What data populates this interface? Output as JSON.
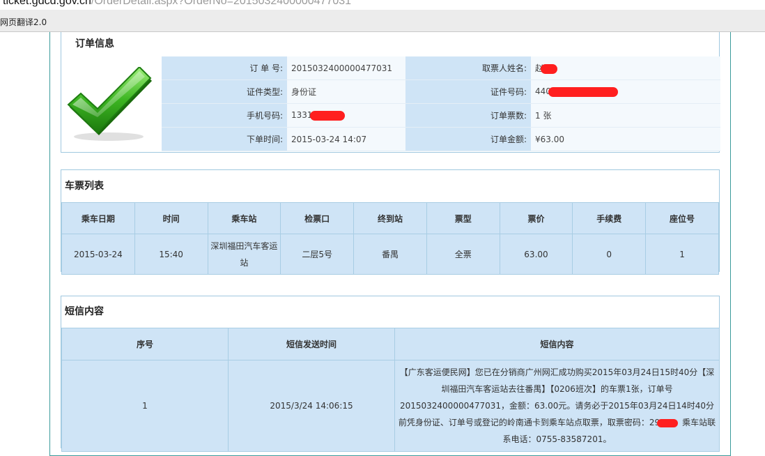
{
  "browser": {
    "url_host": "ticket.gdcd.gov.cn",
    "url_path": "/OrderDetail.aspx?OrderNo=2015032400000477031",
    "extension_label": "网页翻译2.0"
  },
  "order_info": {
    "title": "订单信息",
    "rows": [
      {
        "l1": "订 单 号:",
        "v1": "2015032400000477031",
        "l2": "取票人姓名:",
        "v2": "赵"
      },
      {
        "l1": "证件类型:",
        "v1": "身份证",
        "l2": "证件号码:",
        "v2": "440"
      },
      {
        "l1": "手机号码:",
        "v1": "1331",
        "l2": "订单票数:",
        "v2": "1 张"
      },
      {
        "l1": "下单时间:",
        "v1": "2015-03-24 14:07",
        "l2": "订单金额:",
        "v2": "¥63.00"
      }
    ]
  },
  "ticket_list": {
    "title": "车票列表",
    "columns": [
      "乘车日期",
      "时间",
      "乘车站",
      "检票口",
      "终到站",
      "票型",
      "票价",
      "手续费",
      "座位号"
    ],
    "rows": [
      [
        "2015-03-24",
        "15:40",
        "深圳福田汽车客运站",
        "二层5号",
        "番禺",
        "全票",
        "63.00",
        "0",
        "1"
      ]
    ]
  },
  "sms": {
    "title": "短信内容",
    "columns": [
      "序号",
      "短信发送时间",
      "短信内容"
    ],
    "row": {
      "index": "1",
      "time": "2015/3/24 14:06:15",
      "text_before": "【广东客运便民网】您已在分销商广州网汇成功购买2015年03月24日15时40分【深圳福田汽车客运站去往番禺】【0206班次】的车票1张，订单号2015032400000477031，金额：63.00元。请务必于2015年03月24日14时40分前凭身份证、订单号或登记的岭南通卡到乘车站点取票，取票密码：29",
      "text_after": "乘车站联系电话：0755-83587201。"
    }
  },
  "colors": {
    "label_bg": "#cfe4f6",
    "value_bg": "#f4f9fd",
    "border": "#a8cde4",
    "redaction": "#ff1f1f",
    "check_green": "#3cb521"
  }
}
